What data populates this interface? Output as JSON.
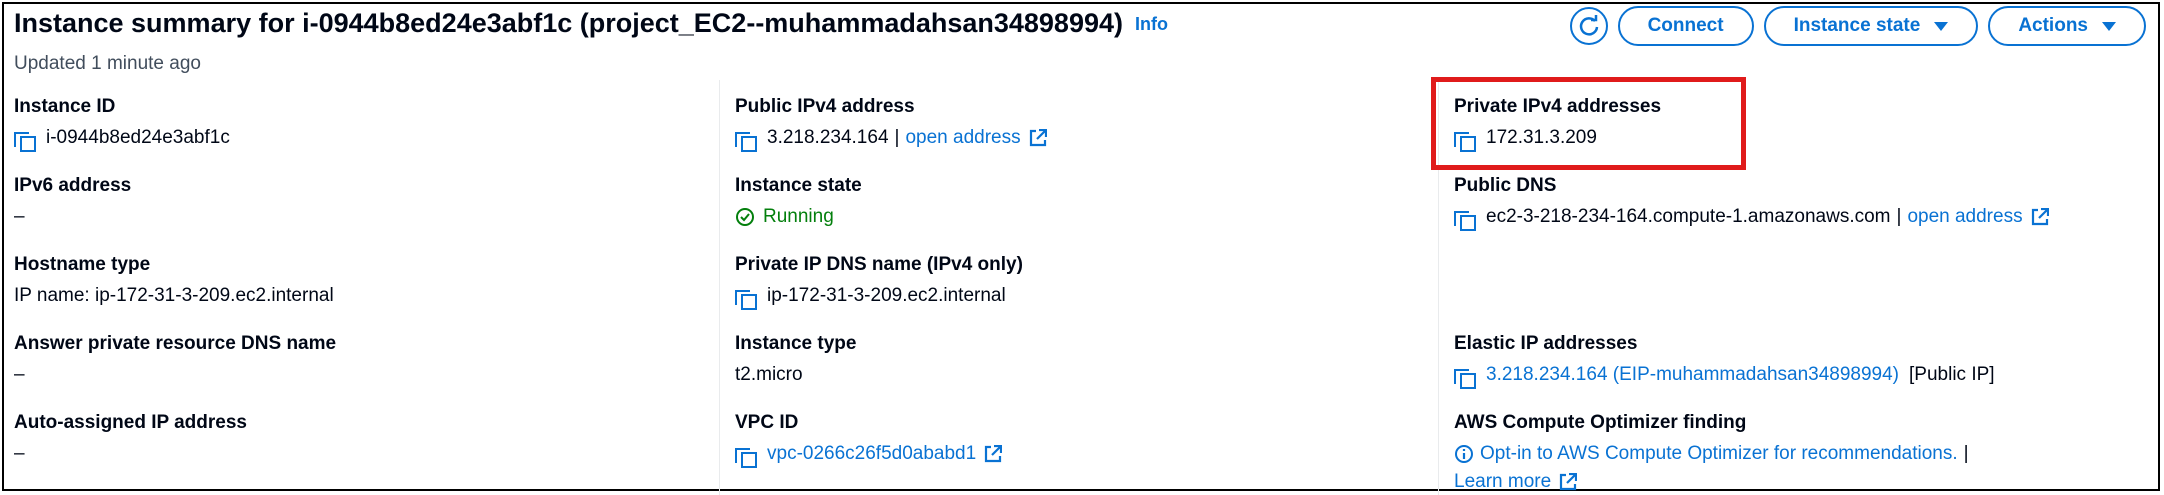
{
  "header": {
    "title": "Instance summary for i-0944b8ed24e3abf1c (project_EC2--muhammadahsan34898994)",
    "info_label": "Info",
    "updated": "Updated 1 minute ago",
    "buttons": {
      "refresh_icon": "refresh-icon",
      "connect": "Connect",
      "instance_state": "Instance state",
      "actions": "Actions"
    }
  },
  "col1": {
    "instance_id": {
      "label": "Instance ID",
      "value": "i-0944b8ed24e3abf1c"
    },
    "ipv6": {
      "label": "IPv6 address",
      "value": "–"
    },
    "hostname_type": {
      "label": "Hostname type",
      "value": "IP name: ip-172-31-3-209.ec2.internal"
    },
    "answer_dns": {
      "label": "Answer private resource DNS name",
      "value": "–"
    },
    "auto_ip": {
      "label": "Auto-assigned IP address",
      "value": "–"
    }
  },
  "col2": {
    "public_ipv4": {
      "label": "Public IPv4 address",
      "value": "3.218.234.164",
      "sep": "|",
      "link": "open address"
    },
    "instance_state": {
      "label": "Instance state",
      "value": "Running"
    },
    "private_dns": {
      "label": "Private IP DNS name (IPv4 only)",
      "value": "ip-172-31-3-209.ec2.internal"
    },
    "instance_type": {
      "label": "Instance type",
      "value": "t2.micro"
    },
    "vpc_id": {
      "label": "VPC ID",
      "value": "vpc-0266c26f5d0ababd1"
    }
  },
  "col3": {
    "private_ipv4": {
      "label": "Private IPv4 addresses",
      "value": "172.31.3.209"
    },
    "public_dns": {
      "label": "Public DNS",
      "value": "ec2-3-218-234-164.compute-1.amazonaws.com",
      "sep": "|",
      "link": "open address"
    },
    "elastic_ip": {
      "label": "Elastic IP addresses",
      "value": "3.218.234.164 (EIP-muhammadahsan34898994)",
      "suffix": "[Public IP]"
    },
    "optimizer": {
      "label": "AWS Compute Optimizer finding",
      "value": "Opt-in to AWS Compute Optimizer for recommendations.",
      "sep": "|",
      "link": "Learn more"
    }
  },
  "colors": {
    "accent": "#0972d3",
    "success": "#037f0c",
    "highlight": "#e01b1b"
  }
}
